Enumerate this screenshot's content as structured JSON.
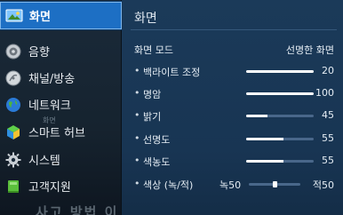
{
  "sidebar": {
    "items": [
      {
        "label": "화면",
        "icon": "picture-icon",
        "active": true
      },
      {
        "label": "음향",
        "icon": "speaker-icon",
        "active": false
      },
      {
        "label": "채널/방송",
        "icon": "satellite-dish-icon",
        "active": false
      },
      {
        "label": "네트워크",
        "icon": "globe-icon",
        "active": false
      },
      {
        "label": "스마트 허브",
        "icon": "smart-hub-cube-icon",
        "active": false
      },
      {
        "label": "시스템",
        "icon": "gear-icon",
        "active": false
      },
      {
        "label": "고객지원",
        "icon": "support-book-icon",
        "active": false
      }
    ],
    "overlay_text": "화면",
    "bottom_text": "사고 방법 이"
  },
  "panel": {
    "title": "화면",
    "mode": {
      "label": "화면 모드",
      "value": "선명한 화면"
    },
    "settings": [
      {
        "label": "백라이트 조정",
        "value": "20",
        "level": 1.0
      },
      {
        "label": "명암",
        "value": "100",
        "level": 1.0
      },
      {
        "label": "밝기",
        "value": "45",
        "level": 0.32
      },
      {
        "label": "선명도",
        "value": "55",
        "level": 0.55
      },
      {
        "label": "색농도",
        "value": "55",
        "level": 0.55
      }
    ],
    "tint": {
      "label": "색상 (녹/적)",
      "left": "녹50",
      "right": "적50",
      "level": 0.5
    }
  },
  "colors": {
    "accent": "#1d6fc4",
    "panel_bg": "#1b3a59",
    "sidebar_bg": "#1a2a3a",
    "slider_fill": "#ffffff",
    "slider_track": "#49678a"
  }
}
